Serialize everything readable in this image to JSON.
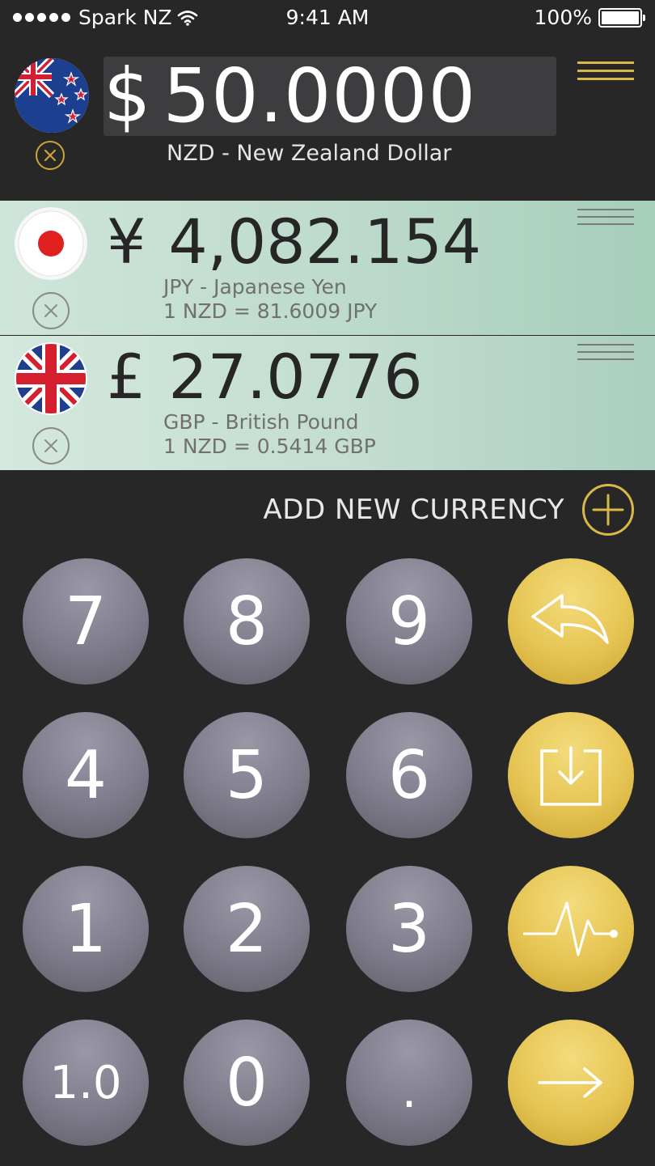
{
  "status_bar": {
    "carrier": "Spark NZ",
    "time": "9:41 AM",
    "battery": "100%"
  },
  "base": {
    "symbol": "$",
    "amount": "50.0000",
    "name": "NZD - New Zealand Dollar",
    "flag": "new-zealand-flag"
  },
  "currencies": [
    {
      "symbol": "¥",
      "amount": "4,082.154",
      "name": "JPY - Japanese Yen",
      "rate": "1 NZD = 81.6009 JPY",
      "flag": "japan-flag"
    },
    {
      "symbol": "£",
      "amount": "27.0776",
      "name": "GBP - British Pound",
      "rate": "1 NZD = 0.5414 GBP",
      "flag": "uk-flag"
    }
  ],
  "add_currency": {
    "label": "ADD NEW CURRENCY"
  },
  "keypad": {
    "keys": [
      "7",
      "8",
      "9",
      "4",
      "5",
      "6",
      "1",
      "2",
      "3",
      "1.0",
      "0",
      "."
    ],
    "actions": [
      "undo-arrow-icon",
      "download-icon",
      "chart-pulse-icon",
      "arrow-right-icon"
    ]
  },
  "colors": {
    "background": "#272727",
    "accent_gold": "#d9b84a",
    "row_green": "#bcdacb",
    "key_gray": "#7e7c8a"
  }
}
